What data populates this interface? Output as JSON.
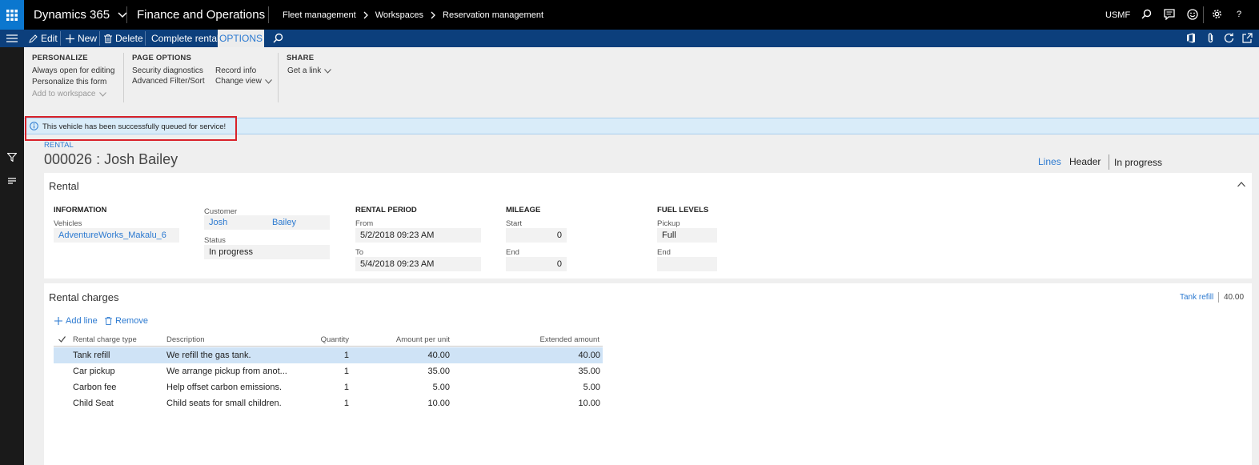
{
  "topbar": {
    "app_name": "Dynamics 365",
    "module": "Finance and Operations",
    "breadcrumbs": [
      "Fleet management",
      "Workspaces",
      "Reservation management"
    ],
    "company": "USMF",
    "icons": [
      "waffle-icon",
      "search-icon",
      "chat-icon",
      "smiley-icon",
      "settings-icon",
      "help-icon"
    ],
    "help_label": "?"
  },
  "actionbar": {
    "edit": "Edit",
    "new": "New",
    "delete": "Delete",
    "complete_rental": "Complete rental",
    "options": "OPTIONS",
    "right_icons": [
      "office-icon",
      "attach-icon",
      "refresh-icon",
      "popout-icon"
    ]
  },
  "ribbon": {
    "personalize": {
      "header": "PERSONALIZE",
      "items": [
        "Always open for editing",
        "Personalize this form",
        "Add to workspace"
      ]
    },
    "page_options": {
      "header": "PAGE OPTIONS",
      "col1": [
        "Security diagnostics",
        "Advanced Filter/Sort"
      ],
      "col2": [
        "Record info",
        "Change view"
      ]
    },
    "share": {
      "header": "SHARE",
      "items": [
        "Get a link"
      ]
    }
  },
  "message": "This vehicle has been successfully queued for service!",
  "record": {
    "kicker": "RENTAL",
    "title": "000026 : Josh Bailey",
    "view_lines": "Lines",
    "view_header": "Header",
    "status": "In progress"
  },
  "rental": {
    "tab_title": "Rental",
    "information": {
      "header": "INFORMATION",
      "vehicles_label": "Vehicles",
      "vehicles_value": "AdventureWorks_Makalu_6"
    },
    "customer": {
      "label": "Customer",
      "first": "Josh",
      "last": "Bailey",
      "status_label": "Status",
      "status_value": "In progress"
    },
    "rental_period": {
      "header": "RENTAL PERIOD",
      "from_label": "From",
      "from_value": "5/2/2018 09:23 AM",
      "to_label": "To",
      "to_value": "5/4/2018 09:23 AM"
    },
    "mileage": {
      "header": "MILEAGE",
      "start_label": "Start",
      "start_value": "0",
      "end_label": "End",
      "end_value": "0"
    },
    "fuel": {
      "header": "FUEL LEVELS",
      "pickup_label": "Pickup",
      "pickup_value": "Full",
      "end_label": "End",
      "end_value": ""
    }
  },
  "charges": {
    "tab_title": "Rental charges",
    "summary_label": "Tank refill",
    "summary_value": "40.00",
    "add_line": "Add line",
    "remove": "Remove",
    "columns": [
      "Rental charge type",
      "Description",
      "Quantity",
      "Amount per unit",
      "Extended amount"
    ],
    "rows": [
      {
        "type": "Tank refill",
        "description": "We refill the gas tank.",
        "quantity": "1",
        "amount_per_unit": "40.00",
        "extended": "40.00",
        "selected": true
      },
      {
        "type": "Car pickup",
        "description": "We arrange pickup from anot...",
        "quantity": "1",
        "amount_per_unit": "35.00",
        "extended": "35.00",
        "selected": false
      },
      {
        "type": "Carbon fee",
        "description": "Help offset carbon emissions.",
        "quantity": "1",
        "amount_per_unit": "5.00",
        "extended": "5.00",
        "selected": false
      },
      {
        "type": "Child Seat",
        "description": "Child seats for small children.",
        "quantity": "1",
        "amount_per_unit": "10.00",
        "extended": "10.00",
        "selected": false
      }
    ]
  },
  "colors": {
    "topbar": "#000000",
    "waffle": "#0b77cf",
    "actionbar": "#0c3f7c",
    "link": "#2b79d0",
    "message_bg": "#d9ecf9",
    "highlight_border": "#d9222a",
    "selected_row": "#cfe3f6"
  }
}
